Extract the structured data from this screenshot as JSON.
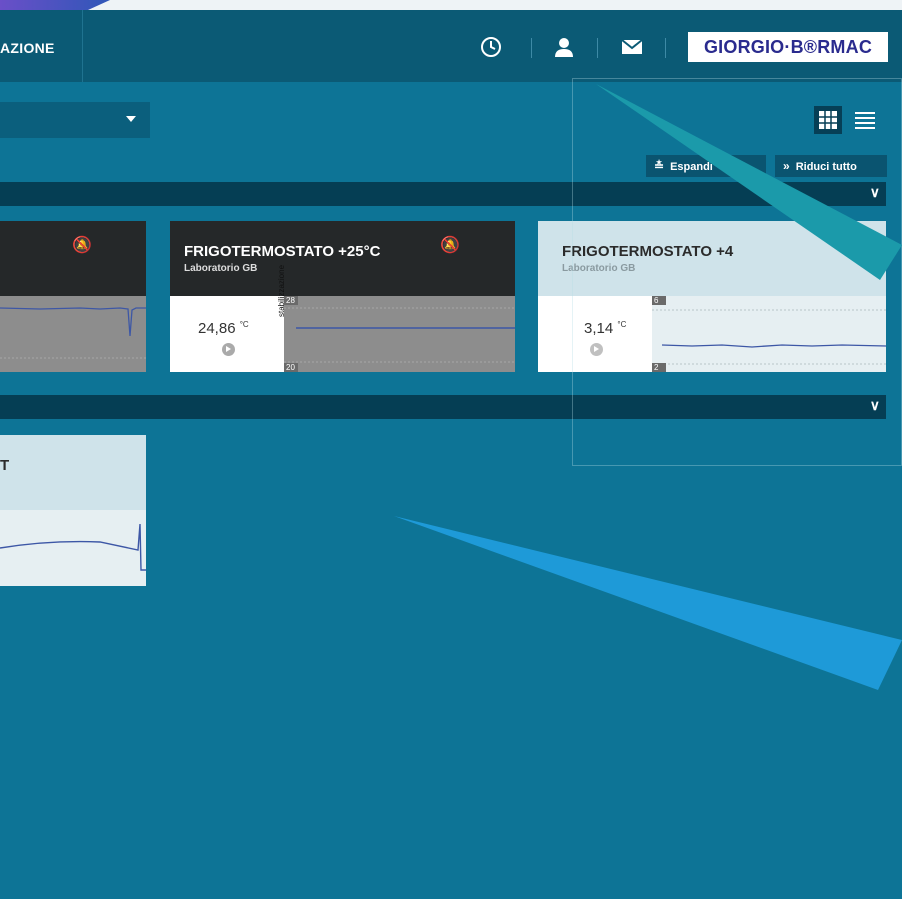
{
  "nav": {
    "section_label": "AZIONE"
  },
  "header": {
    "logo_text": "GIORGIO·B®RMAC",
    "icons": [
      "clock-icon",
      "user-icon",
      "mail-icon"
    ]
  },
  "toolbar": {
    "expand_label": "Espandi",
    "collapse_label": "Riduci tutto"
  },
  "cards": [
    {
      "title": "FRIGOTERMOSTATO +25°C",
      "subtitle": "Laboratorio GB",
      "value": "24,86",
      "unit": "°C",
      "axis_top": "28",
      "axis_bottom": "20",
      "axis_label": "stabilizzazione"
    },
    {
      "title": "FRIGOTERMOSTATO +4",
      "subtitle": "Laboratorio GB",
      "value": "3,14",
      "unit": "°C",
      "axis_top": "6",
      "axis_bottom": "2"
    }
  ],
  "card_partial_title": "T",
  "colors": {
    "background": "#0d7496",
    "topbar": "#0b5a75",
    "groupbar": "#053e54",
    "card_dark_header": "#252829",
    "card_light_header": "#cfe3ea",
    "line": "#3d57a6",
    "arrow_teal": "#1b9aaa",
    "arrow_blue": "#1e9ad8"
  }
}
